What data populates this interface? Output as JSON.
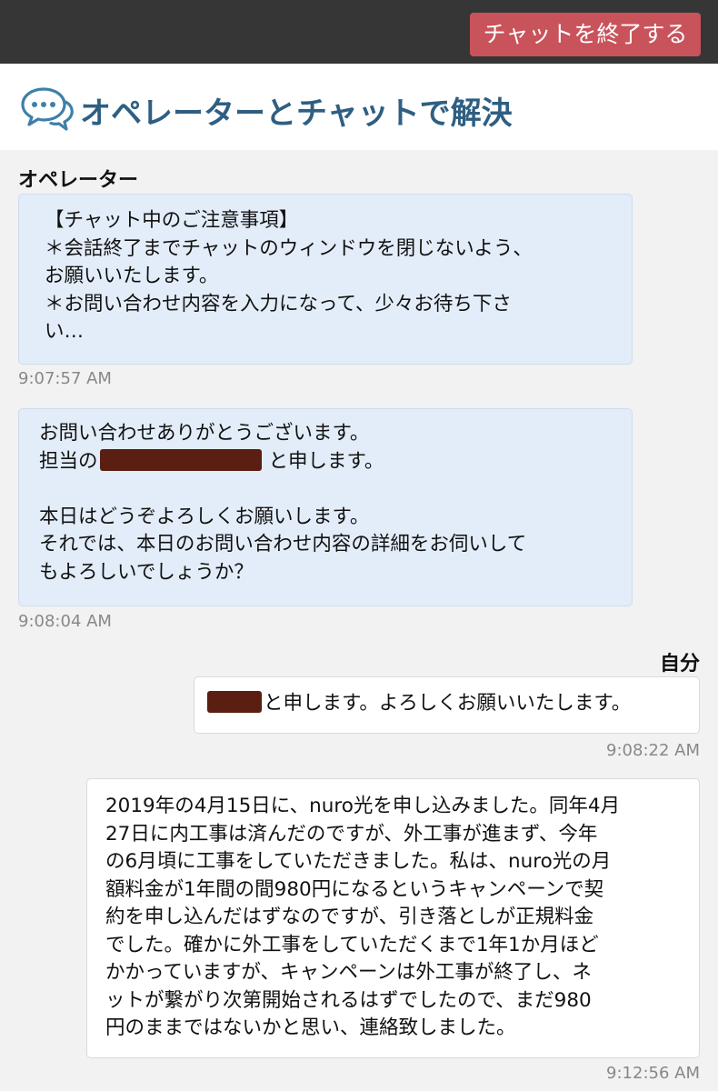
{
  "toolbar": {
    "end_chat_label": "チャットを終了する"
  },
  "header": {
    "icon": "chat-bubbles-icon",
    "title": "オペレーターとチャットで解決"
  },
  "messages": [
    {
      "sender": "オペレーター",
      "lines": [
        "【チャット中のご注意事項】",
        "＊会話終了までチャットのウィンドウを閉じないよう、",
        "お願いいたします。",
        "＊お問い合わせ内容を入力になって、少々お待ち下さ",
        "い…"
      ],
      "time": "9:07:57 AM"
    },
    {
      "lines": [
        "お問い合わせありがとうございます。",
        "担当の",
        "と申します。",
        "",
        "本日はどうぞよろしくお願いします。",
        "それでは、本日のお問い合わせ内容の詳細をお伺いして",
        "もよろしいでしょうか？"
      ],
      "time": "9:08:04 AM"
    },
    {
      "sender": "自分",
      "lines": [
        "と申します。よろしくお願いいたします。"
      ],
      "time": "9:08:22 AM"
    },
    {
      "lines": [
        "2019年の4月15日に、nuro光を申し込みました。同年4月",
        "27日に内工事は済んだのですが、外工事が進まず、今年",
        "の6月頃に工事をしていただきました。私は、nuro光の月",
        "額料金が1年間の間980円になるというキャンペーンで契",
        "約を申し込んだはずなのですが、引き落としが正規料金",
        "でした。確かに外工事をしていただくまで1年1か月ほど",
        "かかっていますが、キャンペーンは外工事が終了し、ネ",
        "ットが繋がり次第開始されるはずでしたので、まだ980",
        "円のままではないかと思い、連絡致しました。"
      ],
      "time": "9:12:56 AM"
    }
  ],
  "colors": {
    "topbar": "#363636",
    "end_button": "#c9535b",
    "title": "#2e5f82",
    "operator_bubble": "#e3edf9",
    "user_bubble": "#ffffff",
    "redaction": "#5a1f12"
  }
}
